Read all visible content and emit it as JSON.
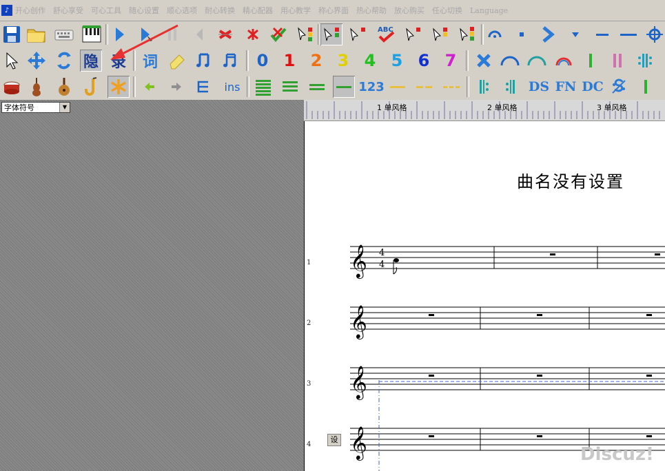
{
  "menu": {
    "items": [
      "开心创作",
      "舒心享受",
      "可心工具",
      "随心设置",
      "顺心选项",
      "耐心转换",
      "精心配器",
      "用心教学",
      "称心界面",
      "热心帮助",
      "放心购买",
      "任心切换",
      "Language"
    ]
  },
  "toolbar": {
    "hide_label": "隐",
    "record_label": "录",
    "lyric_label": "词",
    "numbers": [
      "0",
      "1",
      "2",
      "3",
      "4",
      "5",
      "6",
      "7"
    ],
    "number_colors": [
      "#1c64c8",
      "#e01010",
      "#f07010",
      "#e0d000",
      "#20c020",
      "#20a0e0",
      "#1030d0",
      "#d020d0"
    ],
    "ins_label": "ins",
    "num123_label": "123",
    "ds_label": "DS",
    "fn_label": "FN",
    "dc_label": "DC",
    "abc_label": "ABC"
  },
  "font_select": {
    "value": "字体符号"
  },
  "ruler": {
    "labels": [
      "1 单风格",
      "2 单风格",
      "3 单风格"
    ]
  },
  "score": {
    "title": "曲名没有设置",
    "line_numbers": [
      "1",
      "2",
      "3",
      "4"
    ],
    "time_signature": {
      "top": "4",
      "bottom": "4"
    },
    "set_button": "设"
  },
  "watermark": "Discuz!"
}
